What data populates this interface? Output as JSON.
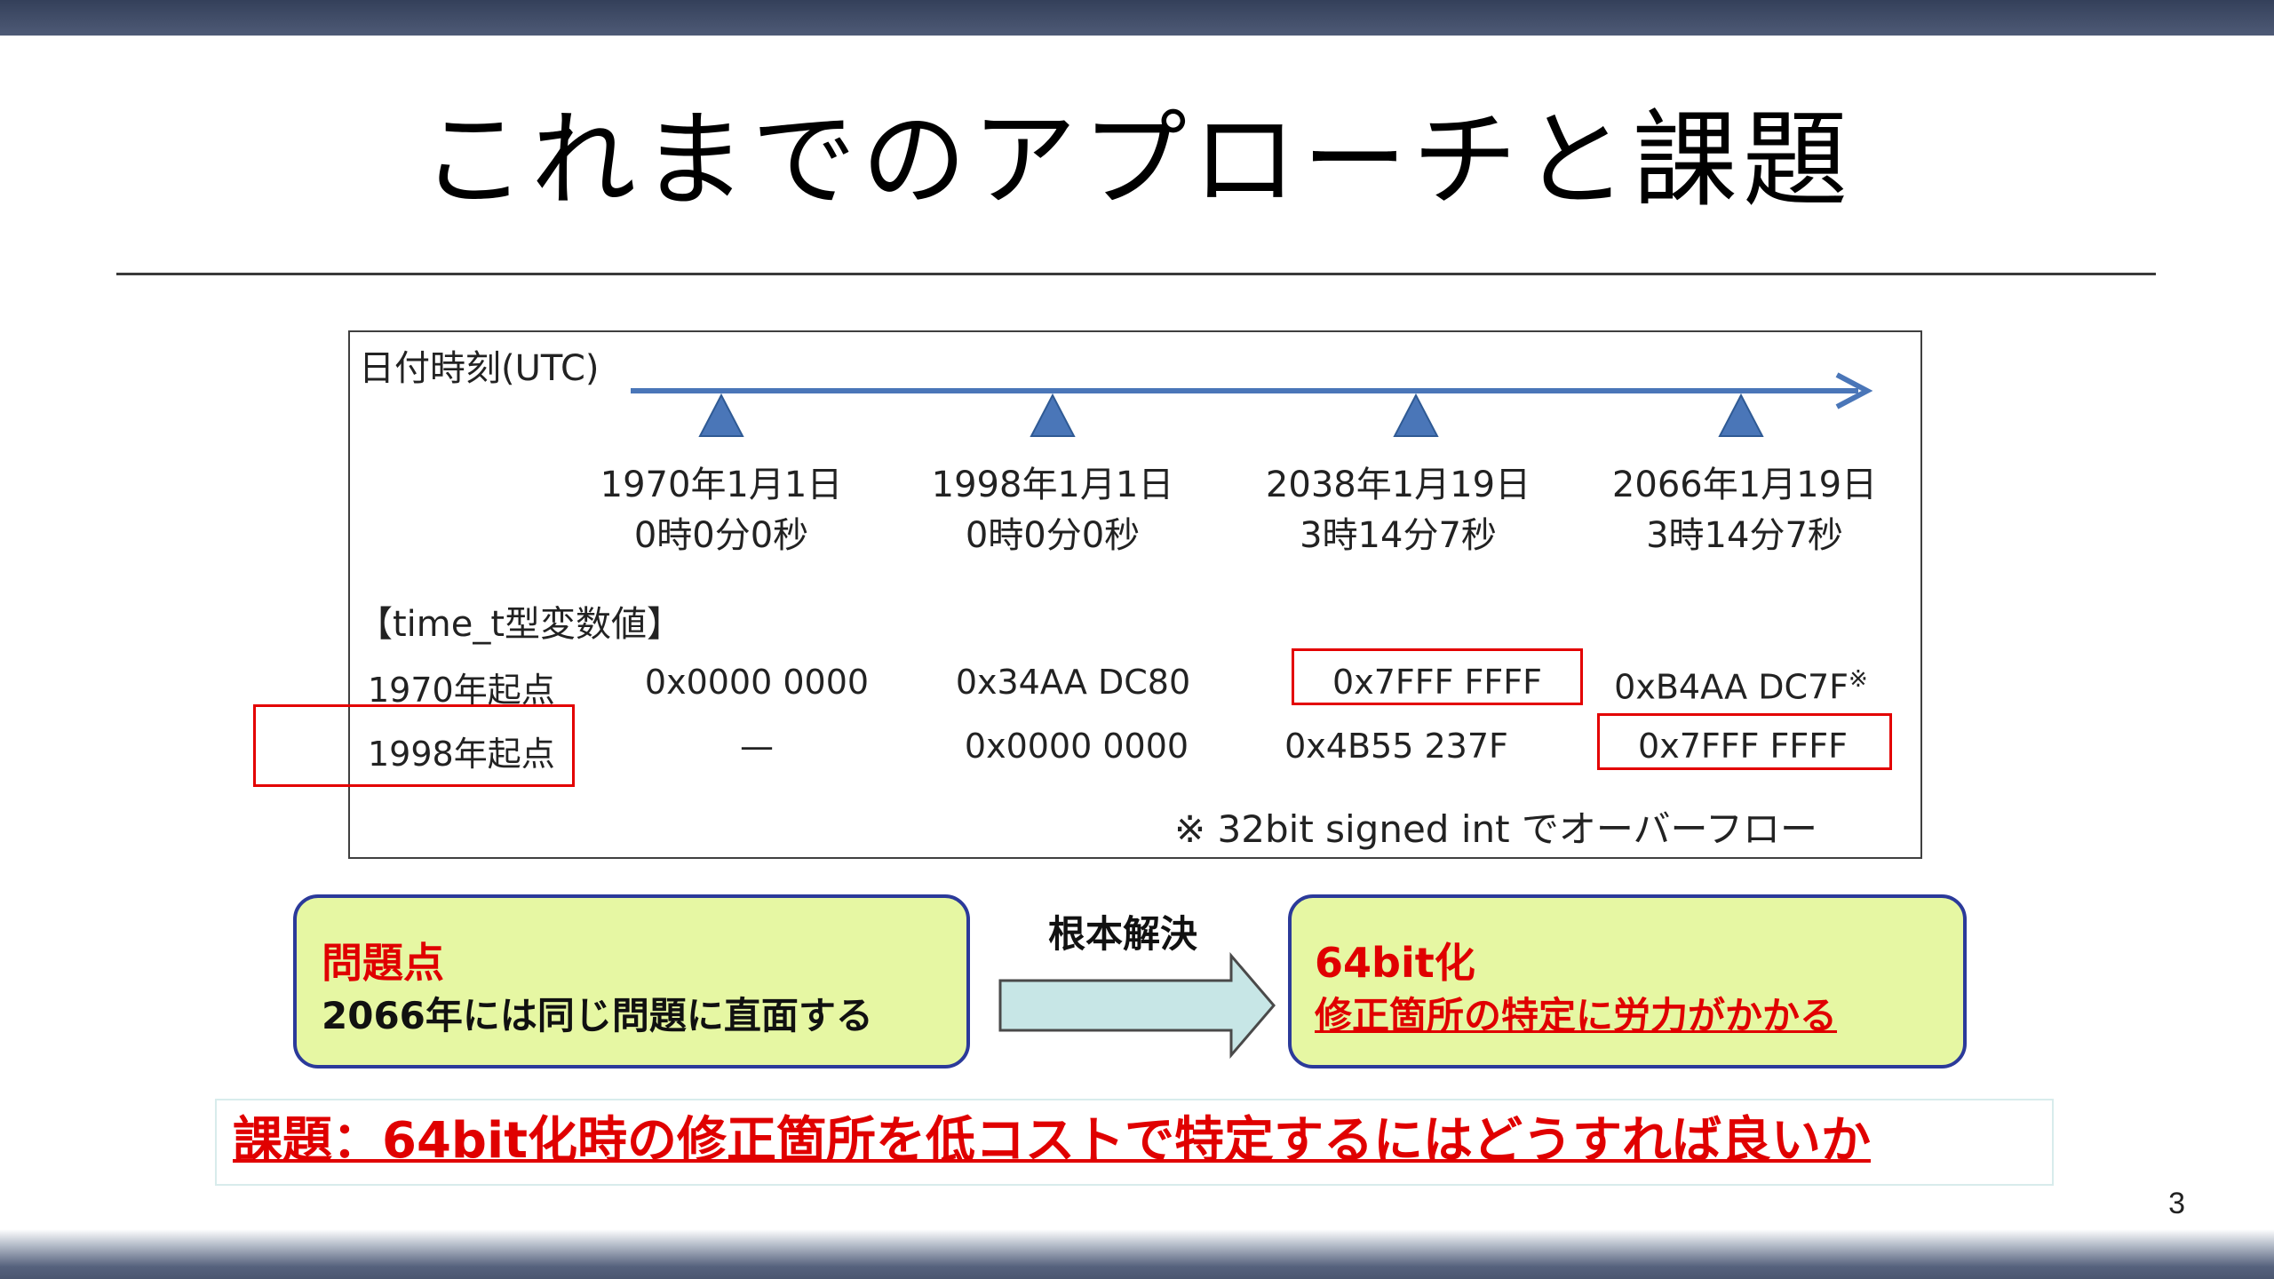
{
  "title": "これまでのアプローチと課題",
  "figure": {
    "axis_label": "日付時刻(UTC)",
    "timeline": [
      {
        "date": "1970年1月1日",
        "time": "0時0分0秒"
      },
      {
        "date": "1998年1月1日",
        "time": "0時0分0秒"
      },
      {
        "date": "2038年1月19日",
        "time": "3時14分7秒"
      },
      {
        "date": "2066年1月19日",
        "time": "3時14分7秒"
      }
    ],
    "values_heading": "【time_t型変数値】",
    "rows": [
      {
        "label": "1970年起点",
        "cells": [
          "0x0000 0000",
          "0x34AA DC80",
          "0x7FFF FFFF",
          "0xB4AA DC7F"
        ],
        "note_mark": "※"
      },
      {
        "label": "1998年起点",
        "cells": [
          "—",
          "0x0000 0000",
          "0x4B55 237F",
          "0x7FFF FFFF"
        ]
      }
    ],
    "footnote": "※  32bit signed int でオーバーフロー"
  },
  "problem": {
    "heading": "問題点",
    "body": "2066年には同じ問題に直面する"
  },
  "arrow_label": "根本解決",
  "solution": {
    "heading": "64bit化",
    "body": "修正箇所の特定に労力がかかる"
  },
  "issue": "課題：64bit化時の修正箇所を低コストで特定するにはどうすれば良いか",
  "page_number": "3",
  "colors": {
    "timeline": "#4a76b8",
    "highlight": "#e30000",
    "panel_fill": "#e6f7a3",
    "panel_border": "#2b3a9a",
    "arrow_fill": "#c7e6e6"
  }
}
